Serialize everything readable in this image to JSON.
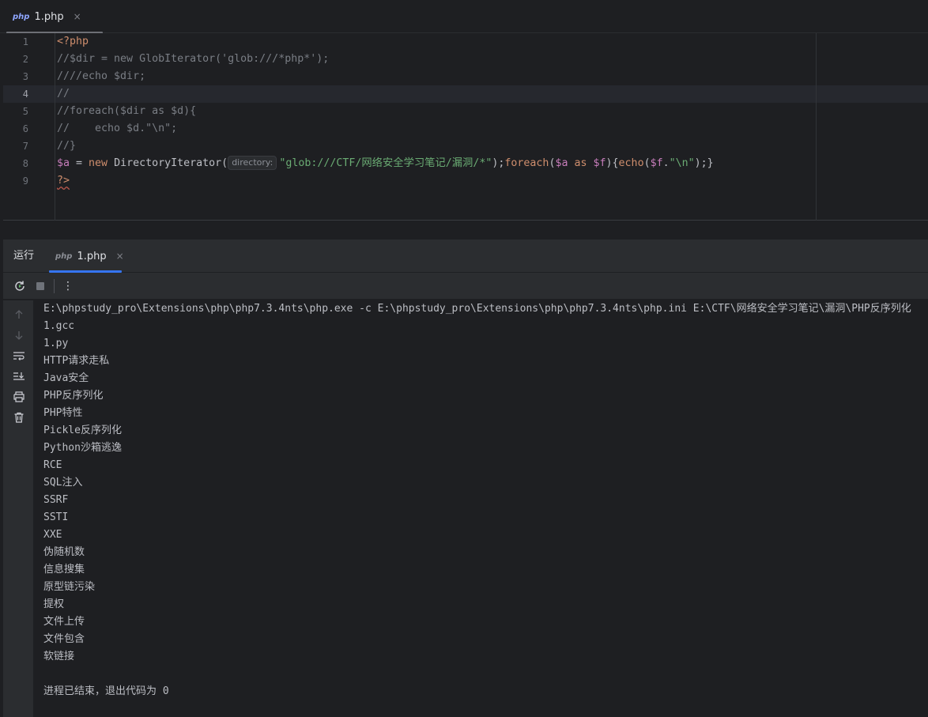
{
  "editor_tab": {
    "icon": "php",
    "label": "1.php",
    "close": "×"
  },
  "editor": {
    "line_numbers": [
      "1",
      "2",
      "3",
      "4",
      "5",
      "6",
      "7",
      "8",
      "9"
    ],
    "current_line": 4,
    "lines": [
      [
        {
          "t": "<?php",
          "c": "kw"
        }
      ],
      [
        {
          "t": "//$dir = new GlobIterator('glob:///*php*');",
          "c": "cmt"
        }
      ],
      [
        {
          "t": "////echo $dir;",
          "c": "cmt"
        }
      ],
      [
        {
          "t": "//",
          "c": "cmt"
        }
      ],
      [
        {
          "t": "//foreach($dir as $d){",
          "c": "cmt"
        }
      ],
      [
        {
          "t": "//    echo $d.\"\\n\";",
          "c": "cmt"
        }
      ],
      [
        {
          "t": "//}",
          "c": "cmt"
        }
      ],
      [
        {
          "t": "$a",
          "c": "var"
        },
        {
          "t": " = ",
          "c": "pun"
        },
        {
          "t": "new",
          "c": "kw"
        },
        {
          "t": " DirectoryIterator(",
          "c": "pun"
        },
        {
          "t": "directory:",
          "c": "hint"
        },
        {
          "t": "\"glob:///CTF/网络安全学习笔记/漏洞/*\"",
          "c": "str"
        },
        {
          "t": ");",
          "c": "pun"
        },
        {
          "t": "foreach",
          "c": "kw"
        },
        {
          "t": "(",
          "c": "pun"
        },
        {
          "t": "$a",
          "c": "var"
        },
        {
          "t": " ",
          "c": "pun"
        },
        {
          "t": "as",
          "c": "kw"
        },
        {
          "t": " ",
          "c": "pun"
        },
        {
          "t": "$f",
          "c": "var"
        },
        {
          "t": "){",
          "c": "pun"
        },
        {
          "t": "echo",
          "c": "kw"
        },
        {
          "t": "(",
          "c": "pun"
        },
        {
          "t": "$f",
          "c": "var"
        },
        {
          "t": ".",
          "c": "pun"
        },
        {
          "t": "\"\\n\"",
          "c": "str"
        },
        {
          "t": ");}",
          "c": "pun"
        }
      ],
      [
        {
          "t": "?>",
          "c": "kw squiggle"
        }
      ]
    ]
  },
  "run_panel": {
    "title": "运行",
    "tab_icon": "php",
    "tab_label": "1.php",
    "tab_close": "×"
  },
  "toolbar": {
    "rerun_icon": "rerun-icon",
    "stop_icon": "stop-icon",
    "more_icon": "more-vertical-icon",
    "more_glyph": "⋮"
  },
  "console": {
    "lines": [
      "E:\\phpstudy_pro\\Extensions\\php\\php7.3.4nts\\php.exe -c E:\\phpstudy_pro\\Extensions\\php\\php7.3.4nts\\php.ini E:\\CTF\\网络安全学习笔记\\漏洞\\PHP反序列化",
      "1.gcc",
      "1.py",
      "HTTP请求走私",
      "Java安全",
      "PHP反序列化",
      "PHP特性",
      "Pickle反序列化",
      "Python沙箱逃逸",
      "RCE",
      "SQL注入",
      "SSRF",
      "SSTI",
      "XXE",
      "伪随机数",
      "信息搜集",
      "原型链污染",
      "提权",
      "文件上传",
      "文件包含",
      "软链接",
      "",
      "进程已结束，退出代码为 0"
    ]
  }
}
